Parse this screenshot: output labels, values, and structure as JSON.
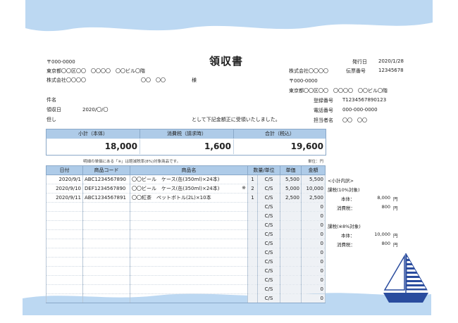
{
  "title": "領収書",
  "colors": {
    "wave": "#bcd8f2",
    "header_fill": "#aecbe8",
    "sail_blue": "#2a4c9e"
  },
  "customer": {
    "postal": "〒000-0000",
    "address": "東京都〇〇区〇〇　〇〇〇〇　〇〇ビル〇階",
    "company": "株式会社〇〇〇〇",
    "person": "〇〇　〇〇",
    "honorific": "様",
    "subject_label": "件名",
    "date_label": "領収日",
    "date_value": "2020/〇/〇",
    "proviso_label": "但し",
    "received_text": "として下記金額正に受領いたしました。"
  },
  "issuer": {
    "issue_date_label": "発行日",
    "issue_date": "2020/1/28",
    "slip_label": "伝票番号",
    "slip_no": "12345678",
    "company": "株式会社〇〇〇〇",
    "postal": "〒000-0000",
    "address": "東京都〇〇区〇〇　〇〇〇〇　〇〇ビル〇階",
    "reg_label": "登録番号",
    "reg_no": "T1234567890123",
    "tel_label": "電話番号",
    "tel": "000-000-0000",
    "staff_label": "担当者名",
    "staff": "〇〇　〇〇"
  },
  "summary": {
    "subtotal_label": "小計（本体）",
    "subtotal": "18,000",
    "tax_label": "消費税（請求時）",
    "tax": "1,600",
    "total_label": "合計（税込）",
    "total": "19,600"
  },
  "note": "明細の単価にある「※」は軽減税率(8%)対象商品です。",
  "unit": "単位：円",
  "columns": [
    "日付",
    "商品コード",
    "商品名",
    "数量/単位",
    "単価",
    "金額"
  ],
  "rows": [
    {
      "date": "2020/9/1",
      "code": "ABC1234567890",
      "name": "〇〇ビール　ケース(缶(350ml)×24本)",
      "mark": "",
      "qty": "1",
      "unit": "C/S",
      "price": "5,500",
      "amount": "5,500"
    },
    {
      "date": "2020/9/10",
      "code": "DEF1234567890",
      "name": "〇〇ビール　ケース(缶(350ml)×24本)",
      "mark": "※",
      "qty": "2",
      "unit": "C/S",
      "price": "5,000",
      "amount": "10,000"
    },
    {
      "date": "2020/9/11",
      "code": "ABC1234567891",
      "name": "〇〇紅茶　ペットボトル(2L)×10本",
      "mark": "",
      "qty": "1",
      "unit": "C/S",
      "price": "2,500",
      "amount": "2,500"
    },
    {
      "date": "",
      "code": "",
      "name": "",
      "mark": "",
      "qty": "",
      "unit": "C/S",
      "price": "",
      "amount": "0"
    },
    {
      "date": "",
      "code": "",
      "name": "",
      "mark": "",
      "qty": "",
      "unit": "C/S",
      "price": "",
      "amount": "0"
    },
    {
      "date": "",
      "code": "",
      "name": "",
      "mark": "",
      "qty": "",
      "unit": "C/S",
      "price": "",
      "amount": "0"
    },
    {
      "date": "",
      "code": "",
      "name": "",
      "mark": "",
      "qty": "",
      "unit": "C/S",
      "price": "",
      "amount": "0"
    },
    {
      "date": "",
      "code": "",
      "name": "",
      "mark": "",
      "qty": "",
      "unit": "C/S",
      "price": "",
      "amount": "0"
    },
    {
      "date": "",
      "code": "",
      "name": "",
      "mark": "",
      "qty": "",
      "unit": "C/S",
      "price": "",
      "amount": "0"
    },
    {
      "date": "",
      "code": "",
      "name": "",
      "mark": "",
      "qty": "",
      "unit": "C/S",
      "price": "",
      "amount": "0"
    },
    {
      "date": "",
      "code": "",
      "name": "",
      "mark": "",
      "qty": "",
      "unit": "C/S",
      "price": "",
      "amount": "0"
    },
    {
      "date": "",
      "code": "",
      "name": "",
      "mark": "",
      "qty": "",
      "unit": "C/S",
      "price": "",
      "amount": "0"
    },
    {
      "date": "",
      "code": "",
      "name": "",
      "mark": "",
      "qty": "",
      "unit": "C/S",
      "price": "",
      "amount": "0"
    },
    {
      "date": "",
      "code": "",
      "name": "",
      "mark": "",
      "qty": "",
      "unit": "C/S",
      "price": "",
      "amount": "0"
    }
  ],
  "breakdown": {
    "title": "<小計内訳>",
    "tax10_label": "課税(10%対象)",
    "tax10_base_label": "本体：",
    "tax10_base": "8,000",
    "tax10_tax_label": "消費税：",
    "tax10_tax": "800",
    "tax8_label": "課税(※8%対象)",
    "tax8_base_label": "本体：",
    "tax8_base": "10,000",
    "tax8_tax_label": "消費税：",
    "tax8_tax": "800",
    "yen": "円"
  }
}
